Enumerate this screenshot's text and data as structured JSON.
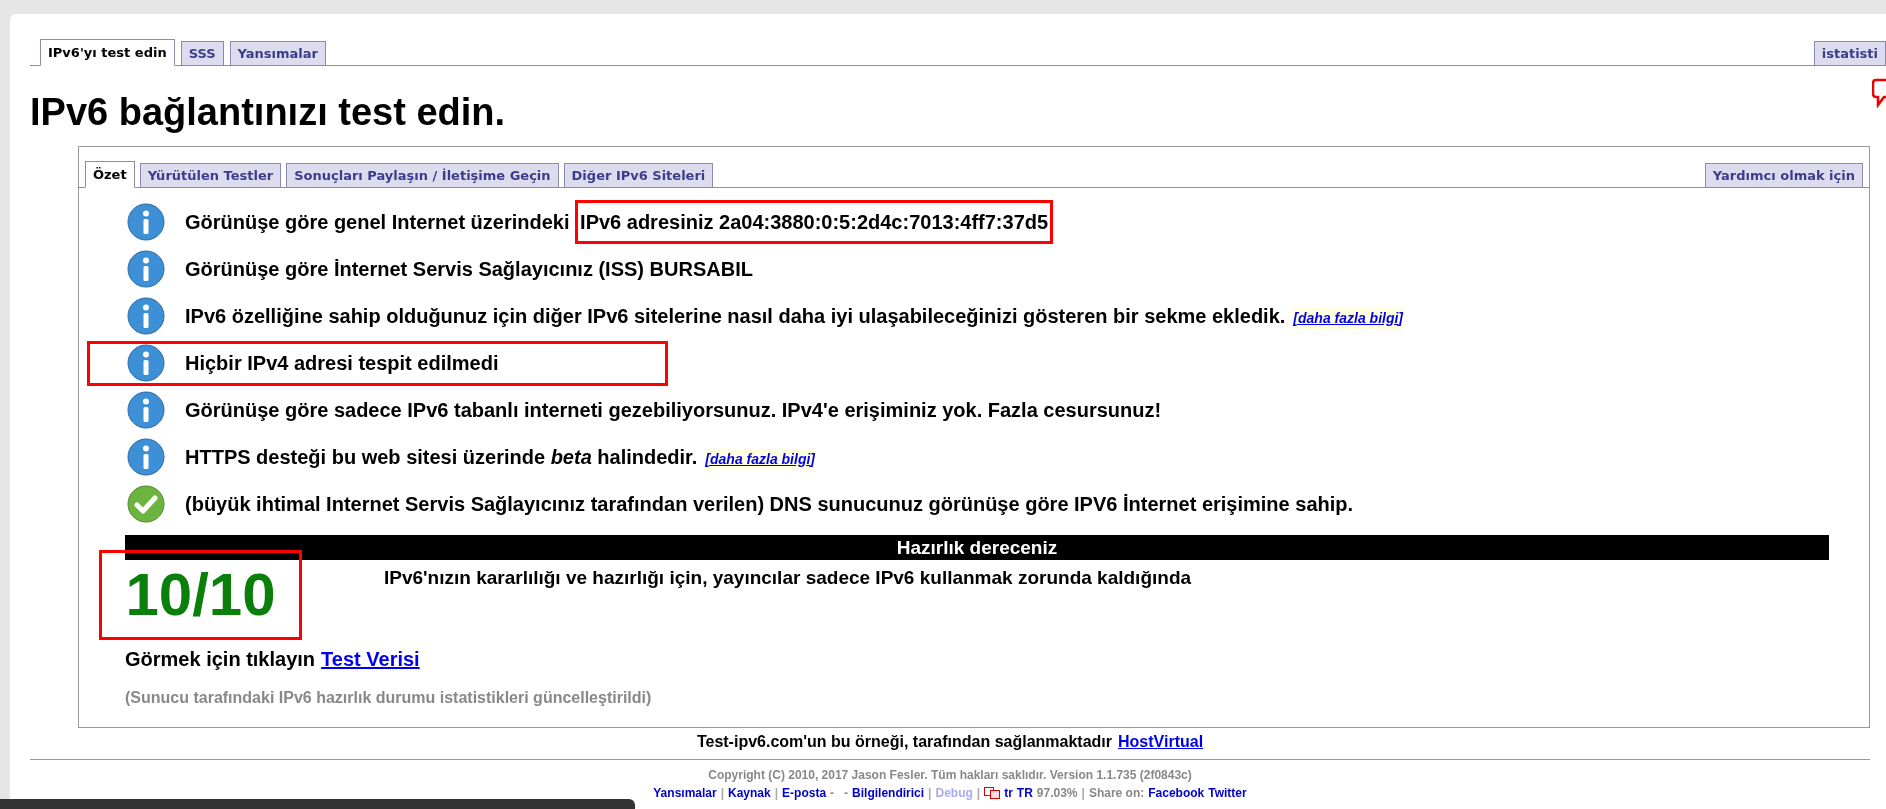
{
  "top_tabs": [
    {
      "label": "IPv6'yı test edin",
      "selected": true
    },
    {
      "label": "SSS",
      "selected": false
    },
    {
      "label": "Yansımalar",
      "selected": false
    }
  ],
  "top_right_tab": {
    "label": "istatisti",
    "selected": false
  },
  "heading": "IPv6 bağlantınızı test edin.",
  "inner_tabs": [
    {
      "label": "Özet",
      "selected": true
    },
    {
      "label": "Yürütülen Testler",
      "selected": false
    },
    {
      "label": "Sonuçları Paylaşın / İletişime Geçin",
      "selected": false
    },
    {
      "label": "Diğer IPv6 Siteleri",
      "selected": false
    }
  ],
  "inner_right_tab": {
    "label": "Yardımcı olmak için",
    "selected": false
  },
  "messages": [
    {
      "kind": "info",
      "text": "Görünüşe göre genel Internet üzerindeki ",
      "highlight": "IPv6 adresiniz 2a04:3880:0:5:2d4c:7013:4ff7:37d5"
    },
    {
      "kind": "info",
      "text": "Görünüşe göre İnternet Servis Sağlayıcınız (ISS) BURSABIL"
    },
    {
      "kind": "info",
      "text": "IPv6 özelliğine sahip olduğunuz için diğer IPv6 sitelerine nasıl daha iyi ulaşabileceğinizi gösteren bir sekme ekledik.",
      "link": "[daha fazla bilgi]"
    },
    {
      "kind": "info",
      "text": "Hiçbir IPv4 adresi tespit edilmedi",
      "row_highlight": true
    },
    {
      "kind": "info",
      "text": "Görünüşe göre sadece IPv6 tabanlı interneti gezebiliyorsunuz. IPv4'e erişiminiz yok. Fazla cesursunuz!"
    },
    {
      "kind": "info",
      "text": "HTTPS desteği bu web sitesi üzerinde *beta* halindedir.",
      "link": "[daha fazla bilgi]"
    },
    {
      "kind": "check",
      "text": "(büyük ihtimal Internet Servis Sağlayıcınız tarafından verilen) DNS sunucunuz görünüşe göre IPV6 İnternet erişimine sahip."
    }
  ],
  "readiness": {
    "title": "Hazırlık dereceniz",
    "score": "10/10",
    "score_highlight": true,
    "note": "IPv6'nızın kararlılığı ve hazırlığı için, yayıncılar sadece IPv6 kullanmak zorunda kaldığında"
  },
  "test_data": {
    "text": "Görmek için tıklayın",
    "link": "Test Verisi"
  },
  "stats_note": "(Sunucu tarafındaki IPv6 hazırlık durumu istatistikleri güncelleştirildi)",
  "sponsor": {
    "text": "Test-ipv6.com'un bu örneği, tarafından sağlanmaktadır",
    "link": "HostVirtual"
  },
  "copyright": "Copyright (C) 2010, 2017 Jason Fesler. Tüm hakları saklıdır. Version 1.1.735 (2f0843c)",
  "footer_items": [
    {
      "kind": "link",
      "text": "Yansımalar"
    },
    {
      "kind": "sep",
      "text": "|"
    },
    {
      "kind": "link",
      "text": "Kaynak"
    },
    {
      "kind": "sep",
      "text": "|"
    },
    {
      "kind": "link",
      "text": "E-posta"
    },
    {
      "kind": "plain",
      "text": "-   -"
    },
    {
      "kind": "link",
      "text": "Bilgilendirici"
    },
    {
      "kind": "sep",
      "text": "|"
    },
    {
      "kind": "disabled",
      "text": "Debug"
    },
    {
      "kind": "sep",
      "text": "|"
    },
    {
      "kind": "icon"
    },
    {
      "kind": "link",
      "text": "tr"
    },
    {
      "kind": "link",
      "text": "TR"
    },
    {
      "kind": "plain",
      "text": "97.03%"
    },
    {
      "kind": "sep",
      "text": "|"
    },
    {
      "kind": "plain",
      "text": "Share on:"
    },
    {
      "kind": "link",
      "text": "Facebook"
    },
    {
      "kind": "link",
      "text": "Twitter"
    }
  ]
}
